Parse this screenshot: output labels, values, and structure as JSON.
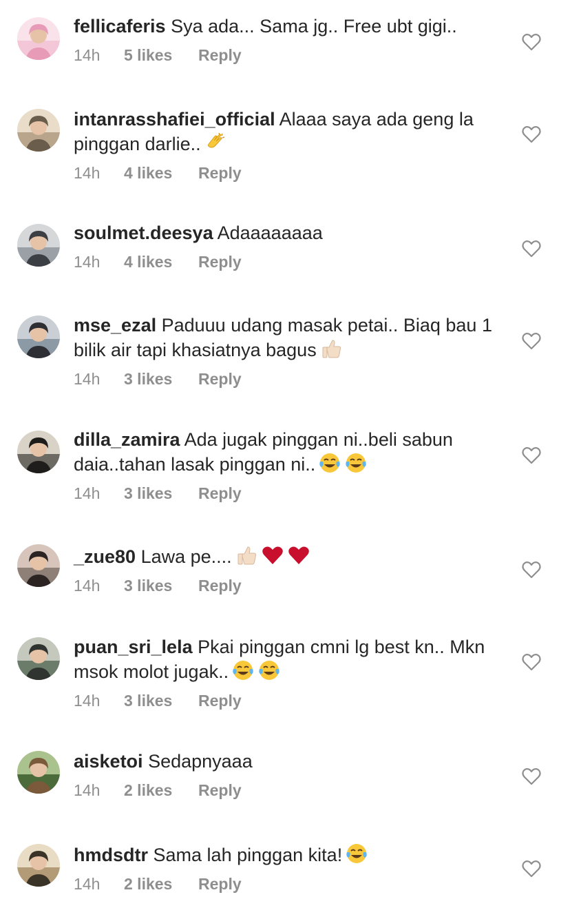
{
  "comments": [
    {
      "username": "fellicaferis",
      "text": "Sya ada... Sama jg.. Free ubt gigi..",
      "emojis": [],
      "time": "14h",
      "likes": "5 likes",
      "reply": "Reply"
    },
    {
      "username": "intanrasshafiei_official",
      "text": "Alaaa saya ada geng la pinggan darlie..",
      "emojis": [
        "clapping-hands"
      ],
      "time": "14h",
      "likes": "4 likes",
      "reply": "Reply"
    },
    {
      "username": "soulmet.deesya",
      "text": "Adaaaaaaaa",
      "emojis": [],
      "time": "14h",
      "likes": "4 likes",
      "reply": "Reply"
    },
    {
      "username": "mse_ezal",
      "text": "Paduuu udang masak petai.. Biaq bau 1 bilik air tapi khasiatnya bagus",
      "emojis": [
        "thumbs-up"
      ],
      "time": "14h",
      "likes": "3 likes",
      "reply": "Reply"
    },
    {
      "username": "dilla_zamira",
      "text": "Ada jugak pinggan ni..beli sabun daia..tahan lasak pinggan ni..",
      "emojis": [
        "tears-of-joy",
        "tears-of-joy"
      ],
      "time": "14h",
      "likes": "3 likes",
      "reply": "Reply"
    },
    {
      "username": "_zue80",
      "text": "Lawa pe....",
      "emojis": [
        "thumbs-up",
        "red-heart",
        "red-heart"
      ],
      "time": "14h",
      "likes": "3 likes",
      "reply": "Reply"
    },
    {
      "username": "puan_sri_lela",
      "text": "Pkai pinggan cmni lg best kn.. Mkn msok molot jugak..",
      "emojis": [
        "tears-of-joy",
        "tears-of-joy"
      ],
      "time": "14h",
      "likes": "3 likes",
      "reply": "Reply"
    },
    {
      "username": "aisketoi",
      "text": "Sedapnyaaa",
      "emojis": [],
      "time": "14h",
      "likes": "2 likes",
      "reply": "Reply"
    },
    {
      "username": "hmdsdtr",
      "text": "Sama lah pinggan kita!",
      "emojis": [
        "tears-of-joy"
      ],
      "time": "14h",
      "likes": "2 likes",
      "reply": "Reply"
    }
  ],
  "colors": {
    "text": "#262626",
    "meta": "#8e8e8e",
    "heart_outline": "#8e8e8e"
  }
}
